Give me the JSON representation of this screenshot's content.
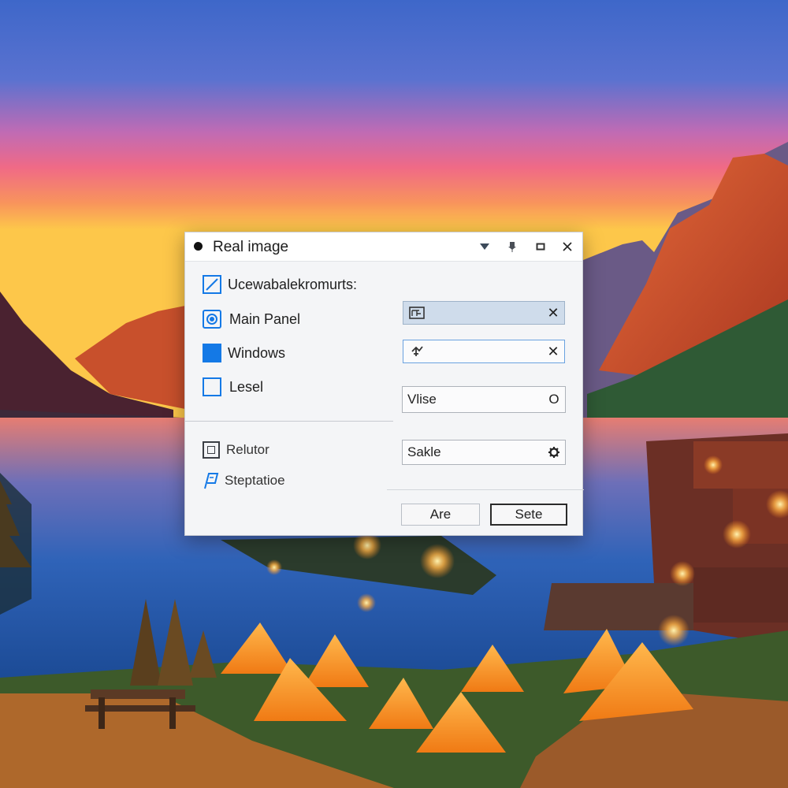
{
  "dialog": {
    "title": "Real image",
    "titlebar_buttons": [
      {
        "icon": "chevron-down-icon"
      },
      {
        "icon": "pin-icon"
      },
      {
        "icon": "maximize-icon"
      },
      {
        "icon": "close-icon"
      }
    ]
  },
  "left_panel": {
    "items": [
      {
        "label": "Ucewabalekromurts:",
        "icon": "resize-icon"
      },
      {
        "label": "Main Panel",
        "icon": "radio-icon"
      },
      {
        "label": "Windows",
        "icon": "filled-square-icon"
      },
      {
        "label": "Lesel",
        "icon": "empty-square-icon"
      },
      {
        "label": "Relutor",
        "icon": "box-icon"
      },
      {
        "label": "Steptatioe",
        "icon": "flag-icon"
      }
    ]
  },
  "fields": [
    {
      "value": "",
      "prefix_icon": "image-icon",
      "suffix": "✕",
      "highlighted": true
    },
    {
      "value": "",
      "prefix_icon": "gear-icon",
      "suffix": "✕",
      "highlighted": false
    },
    {
      "value": "Vlise",
      "suffix": "O"
    },
    {
      "value": "Sakle",
      "suffix_icon": "settings-icon"
    }
  ],
  "buttons": {
    "are": "Are",
    "sete": "Sete"
  },
  "colors": {
    "accent": "#1479e6",
    "dialog_bg": "#f4f5f7",
    "field_highlight": "#cfdceb"
  }
}
